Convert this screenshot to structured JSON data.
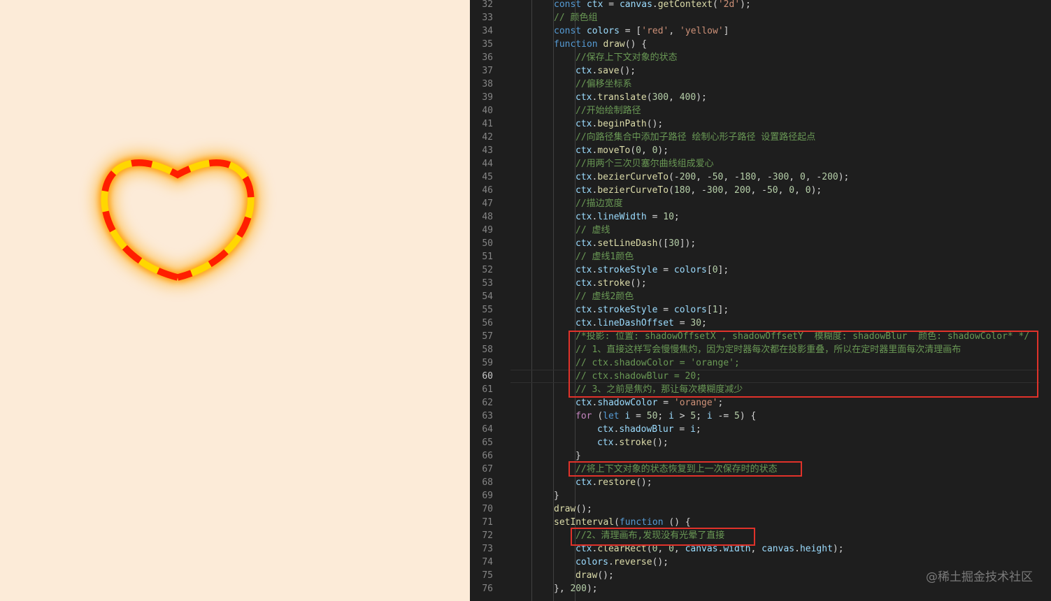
{
  "canvas": {
    "background": "#fcebd8",
    "dash_colors": [
      "#ff1e00",
      "#ffd700"
    ],
    "glow_color": "#ffa500"
  },
  "editor": {
    "lines": [
      {
        "n": "32",
        "indent": 0,
        "t": [
          [
            "k",
            "const "
          ],
          [
            "v",
            "ctx"
          ],
          [
            "p",
            " = "
          ],
          [
            "v",
            "canvas"
          ],
          [
            "p",
            "."
          ],
          [
            "f",
            "getContext"
          ],
          [
            "p",
            "("
          ],
          [
            "s",
            "'2d'"
          ],
          [
            "p",
            ");"
          ]
        ]
      },
      {
        "n": "33",
        "indent": 0,
        "t": [
          [
            "c",
            "// 颜色组"
          ]
        ]
      },
      {
        "n": "34",
        "indent": 0,
        "t": [
          [
            "k",
            "const "
          ],
          [
            "v",
            "colors"
          ],
          [
            "p",
            " = ["
          ],
          [
            "s",
            "'red'"
          ],
          [
            "p",
            ", "
          ],
          [
            "s",
            "'yellow'"
          ],
          [
            "p",
            "]"
          ]
        ]
      },
      {
        "n": "35",
        "indent": 0,
        "t": [
          [
            "k",
            "function "
          ],
          [
            "f",
            "draw"
          ],
          [
            "p",
            "() {"
          ]
        ]
      },
      {
        "n": "36",
        "indent": 1,
        "t": [
          [
            "c",
            "//保存上下文对象的状态"
          ]
        ]
      },
      {
        "n": "37",
        "indent": 1,
        "t": [
          [
            "v",
            "ctx"
          ],
          [
            "p",
            "."
          ],
          [
            "f",
            "save"
          ],
          [
            "p",
            "();"
          ]
        ]
      },
      {
        "n": "38",
        "indent": 1,
        "t": [
          [
            "c",
            "//偏移坐标系"
          ]
        ]
      },
      {
        "n": "39",
        "indent": 1,
        "t": [
          [
            "v",
            "ctx"
          ],
          [
            "p",
            "."
          ],
          [
            "f",
            "translate"
          ],
          [
            "p",
            "("
          ],
          [
            "n",
            "300"
          ],
          [
            "p",
            ", "
          ],
          [
            "n",
            "400"
          ],
          [
            "p",
            ");"
          ]
        ]
      },
      {
        "n": "40",
        "indent": 1,
        "t": [
          [
            "c",
            "//开始绘制路径"
          ]
        ]
      },
      {
        "n": "41",
        "indent": 1,
        "t": [
          [
            "v",
            "ctx"
          ],
          [
            "p",
            "."
          ],
          [
            "f",
            "beginPath"
          ],
          [
            "p",
            "();"
          ]
        ]
      },
      {
        "n": "42",
        "indent": 1,
        "t": [
          [
            "c",
            "//向路径集合中添加子路径 绘制心形子路径 设置路径起点"
          ]
        ]
      },
      {
        "n": "43",
        "indent": 1,
        "t": [
          [
            "v",
            "ctx"
          ],
          [
            "p",
            "."
          ],
          [
            "f",
            "moveTo"
          ],
          [
            "p",
            "("
          ],
          [
            "n",
            "0"
          ],
          [
            "p",
            ", "
          ],
          [
            "n",
            "0"
          ],
          [
            "p",
            ");"
          ]
        ]
      },
      {
        "n": "44",
        "indent": 1,
        "t": [
          [
            "c",
            "//用两个三次贝塞尔曲线组成爱心"
          ]
        ]
      },
      {
        "n": "45",
        "indent": 1,
        "t": [
          [
            "v",
            "ctx"
          ],
          [
            "p",
            "."
          ],
          [
            "f",
            "bezierCurveTo"
          ],
          [
            "p",
            "(-"
          ],
          [
            "n",
            "200"
          ],
          [
            "p",
            ", -"
          ],
          [
            "n",
            "50"
          ],
          [
            "p",
            ", -"
          ],
          [
            "n",
            "180"
          ],
          [
            "p",
            ", -"
          ],
          [
            "n",
            "300"
          ],
          [
            "p",
            ", "
          ],
          [
            "n",
            "0"
          ],
          [
            "p",
            ", -"
          ],
          [
            "n",
            "200"
          ],
          [
            "p",
            ");"
          ]
        ]
      },
      {
        "n": "46",
        "indent": 1,
        "t": [
          [
            "v",
            "ctx"
          ],
          [
            "p",
            "."
          ],
          [
            "f",
            "bezierCurveTo"
          ],
          [
            "p",
            "("
          ],
          [
            "n",
            "180"
          ],
          [
            "p",
            ", -"
          ],
          [
            "n",
            "300"
          ],
          [
            "p",
            ", "
          ],
          [
            "n",
            "200"
          ],
          [
            "p",
            ", -"
          ],
          [
            "n",
            "50"
          ],
          [
            "p",
            ", "
          ],
          [
            "n",
            "0"
          ],
          [
            "p",
            ", "
          ],
          [
            "n",
            "0"
          ],
          [
            "p",
            ");"
          ]
        ]
      },
      {
        "n": "47",
        "indent": 1,
        "t": [
          [
            "c",
            "//描边宽度"
          ]
        ]
      },
      {
        "n": "48",
        "indent": 1,
        "t": [
          [
            "v",
            "ctx"
          ],
          [
            "p",
            "."
          ],
          [
            "v",
            "lineWidth"
          ],
          [
            "p",
            " = "
          ],
          [
            "n",
            "10"
          ],
          [
            "p",
            ";"
          ]
        ]
      },
      {
        "n": "49",
        "indent": 1,
        "t": [
          [
            "c",
            "// 虚线"
          ]
        ]
      },
      {
        "n": "50",
        "indent": 1,
        "t": [
          [
            "v",
            "ctx"
          ],
          [
            "p",
            "."
          ],
          [
            "f",
            "setLineDash"
          ],
          [
            "p",
            "(["
          ],
          [
            "n",
            "30"
          ],
          [
            "p",
            "]);"
          ]
        ]
      },
      {
        "n": "51",
        "indent": 1,
        "t": [
          [
            "c",
            "// 虚线1颜色"
          ]
        ]
      },
      {
        "n": "52",
        "indent": 1,
        "t": [
          [
            "v",
            "ctx"
          ],
          [
            "p",
            "."
          ],
          [
            "v",
            "strokeStyle"
          ],
          [
            "p",
            " = "
          ],
          [
            "v",
            "colors"
          ],
          [
            "p",
            "["
          ],
          [
            "n",
            "0"
          ],
          [
            "p",
            "];"
          ]
        ]
      },
      {
        "n": "53",
        "indent": 1,
        "t": [
          [
            "v",
            "ctx"
          ],
          [
            "p",
            "."
          ],
          [
            "f",
            "stroke"
          ],
          [
            "p",
            "();"
          ]
        ]
      },
      {
        "n": "54",
        "indent": 1,
        "t": [
          [
            "c",
            "// 虚线2颜色"
          ]
        ]
      },
      {
        "n": "55",
        "indent": 1,
        "t": [
          [
            "v",
            "ctx"
          ],
          [
            "p",
            "."
          ],
          [
            "v",
            "strokeStyle"
          ],
          [
            "p",
            " = "
          ],
          [
            "v",
            "colors"
          ],
          [
            "p",
            "["
          ],
          [
            "n",
            "1"
          ],
          [
            "p",
            "];"
          ]
        ]
      },
      {
        "n": "56",
        "indent": 1,
        "t": [
          [
            "v",
            "ctx"
          ],
          [
            "p",
            "."
          ],
          [
            "v",
            "lineDashOffset"
          ],
          [
            "p",
            " = "
          ],
          [
            "n",
            "30"
          ],
          [
            "p",
            ";"
          ]
        ]
      },
      {
        "n": "57",
        "indent": 1,
        "t": [
          [
            "c",
            "/*投影: 位置: shadowOffsetX , shadowOffsetY  模糊度: shadowBlur  颜色: shadowColor* */"
          ]
        ]
      },
      {
        "n": "58",
        "indent": 1,
        "t": [
          [
            "c",
            "// 1、直接这样写会慢慢焦灼，因为定时器每次都在投影重叠，所以在定时器里面每次清理画布"
          ]
        ]
      },
      {
        "n": "59",
        "indent": 1,
        "t": [
          [
            "c",
            "// ctx.shadowColor = 'orange';"
          ]
        ]
      },
      {
        "n": "60",
        "indent": 1,
        "t": [
          [
            "c",
            "// ctx.shadowBlur = 20;"
          ]
        ]
      },
      {
        "n": "61",
        "indent": 1,
        "t": [
          [
            "c",
            "// 3、之前是焦灼，那让每次模糊度减少"
          ]
        ]
      },
      {
        "n": "62",
        "indent": 1,
        "t": [
          [
            "v",
            "ctx"
          ],
          [
            "p",
            "."
          ],
          [
            "v",
            "shadowColor"
          ],
          [
            "p",
            " = "
          ],
          [
            "s",
            "'orange'"
          ],
          [
            "p",
            ";"
          ]
        ]
      },
      {
        "n": "63",
        "indent": 1,
        "t": [
          [
            "kf",
            "for "
          ],
          [
            "p",
            "("
          ],
          [
            "k",
            "let "
          ],
          [
            "v",
            "i"
          ],
          [
            "p",
            " = "
          ],
          [
            "n",
            "50"
          ],
          [
            "p",
            "; "
          ],
          [
            "v",
            "i"
          ],
          [
            "p",
            " > "
          ],
          [
            "n",
            "5"
          ],
          [
            "p",
            "; "
          ],
          [
            "v",
            "i"
          ],
          [
            "p",
            " -= "
          ],
          [
            "n",
            "5"
          ],
          [
            "p",
            ") {"
          ]
        ]
      },
      {
        "n": "64",
        "indent": 2,
        "t": [
          [
            "v",
            "ctx"
          ],
          [
            "p",
            "."
          ],
          [
            "v",
            "shadowBlur"
          ],
          [
            "p",
            " = "
          ],
          [
            "v",
            "i"
          ],
          [
            "p",
            ";"
          ]
        ]
      },
      {
        "n": "65",
        "indent": 2,
        "t": [
          [
            "v",
            "ctx"
          ],
          [
            "p",
            "."
          ],
          [
            "f",
            "stroke"
          ],
          [
            "p",
            "();"
          ]
        ]
      },
      {
        "n": "66",
        "indent": 1,
        "t": [
          [
            "p",
            "}"
          ]
        ]
      },
      {
        "n": "67",
        "indent": 1,
        "t": [
          [
            "c",
            "//将上下文对象的状态恢复到上一次保存时的状态"
          ]
        ]
      },
      {
        "n": "68",
        "indent": 1,
        "t": [
          [
            "v",
            "ctx"
          ],
          [
            "p",
            "."
          ],
          [
            "f",
            "restore"
          ],
          [
            "p",
            "();"
          ]
        ]
      },
      {
        "n": "69",
        "indent": 0,
        "t": [
          [
            "p",
            "}"
          ]
        ]
      },
      {
        "n": "70",
        "indent": 0,
        "t": [
          [
            "f",
            "draw"
          ],
          [
            "p",
            "();"
          ]
        ]
      },
      {
        "n": "71",
        "indent": 0,
        "t": [
          [
            "f",
            "setInterval"
          ],
          [
            "p",
            "("
          ],
          [
            "k",
            "function"
          ],
          [
            "p",
            " () {"
          ]
        ]
      },
      {
        "n": "72",
        "indent": 1,
        "t": [
          [
            "c",
            "//2、清理画布,发现没有光晕了直接"
          ]
        ]
      },
      {
        "n": "73",
        "indent": 1,
        "t": [
          [
            "v",
            "ctx"
          ],
          [
            "p",
            "."
          ],
          [
            "f",
            "clearRect"
          ],
          [
            "p",
            "("
          ],
          [
            "n",
            "0"
          ],
          [
            "p",
            ", "
          ],
          [
            "n",
            "0"
          ],
          [
            "p",
            ", "
          ],
          [
            "v",
            "canvas"
          ],
          [
            "p",
            "."
          ],
          [
            "v",
            "width"
          ],
          [
            "p",
            ", "
          ],
          [
            "v",
            "canvas"
          ],
          [
            "p",
            "."
          ],
          [
            "v",
            "height"
          ],
          [
            "p",
            ");"
          ]
        ]
      },
      {
        "n": "74",
        "indent": 1,
        "t": [
          [
            "v",
            "colors"
          ],
          [
            "p",
            "."
          ],
          [
            "f",
            "reverse"
          ],
          [
            "p",
            "();"
          ]
        ]
      },
      {
        "n": "75",
        "indent": 1,
        "t": [
          [
            "f",
            "draw"
          ],
          [
            "p",
            "();"
          ]
        ]
      },
      {
        "n": "76",
        "indent": 0,
        "t": [
          [
            "p",
            "}, "
          ],
          [
            "n",
            "200"
          ],
          [
            "p",
            ");"
          ]
        ]
      }
    ],
    "current_line": "60"
  },
  "watermark": "@稀土掘金技术社区",
  "annotation_color": "#e0322a"
}
